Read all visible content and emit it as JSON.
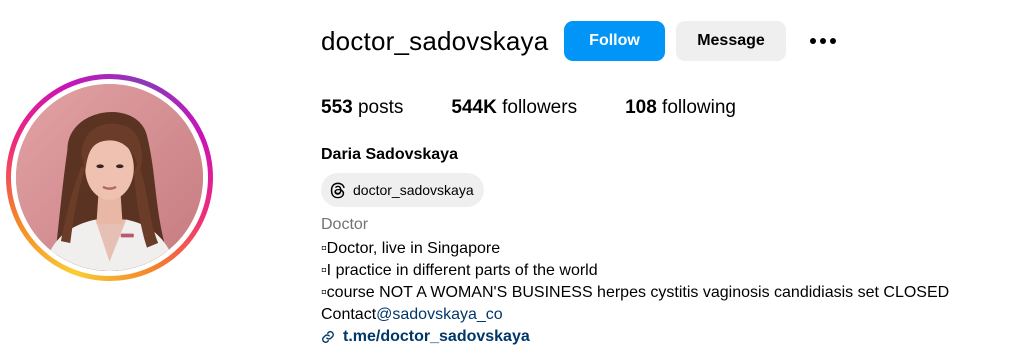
{
  "profile": {
    "username": "doctor_sadovskaya",
    "follow_label": "Follow",
    "message_label": "Message",
    "more_icon": "more-options-icon"
  },
  "stats": {
    "posts_count": "553",
    "posts_label": " posts",
    "followers_count": "544K",
    "followers_label": " followers",
    "following_count": "108",
    "following_label": " following"
  },
  "bio": {
    "full_name": "Daria Sadovskaya",
    "threads_handle": "doctor_sadovskaya",
    "threads_icon": "threads-icon",
    "category": "Doctor",
    "lines": [
      "▫Doctor, live in Singapore",
      "▫I practice in different parts of the world",
      "▫course NOT A WOMAN'S BUSINESS herpes cystitis vaginosis candidiasis set CLOSED"
    ],
    "contact_prefix": "Contact",
    "contact_handle": "@sadovskaya_co",
    "link_icon": "link-icon",
    "external_link": "t.me/doctor_sadovskaya"
  },
  "colors": {
    "primary_blue": "#0095f6",
    "secondary_button": "#efefef",
    "link_color": "#00376b",
    "muted_text": "#737373"
  }
}
